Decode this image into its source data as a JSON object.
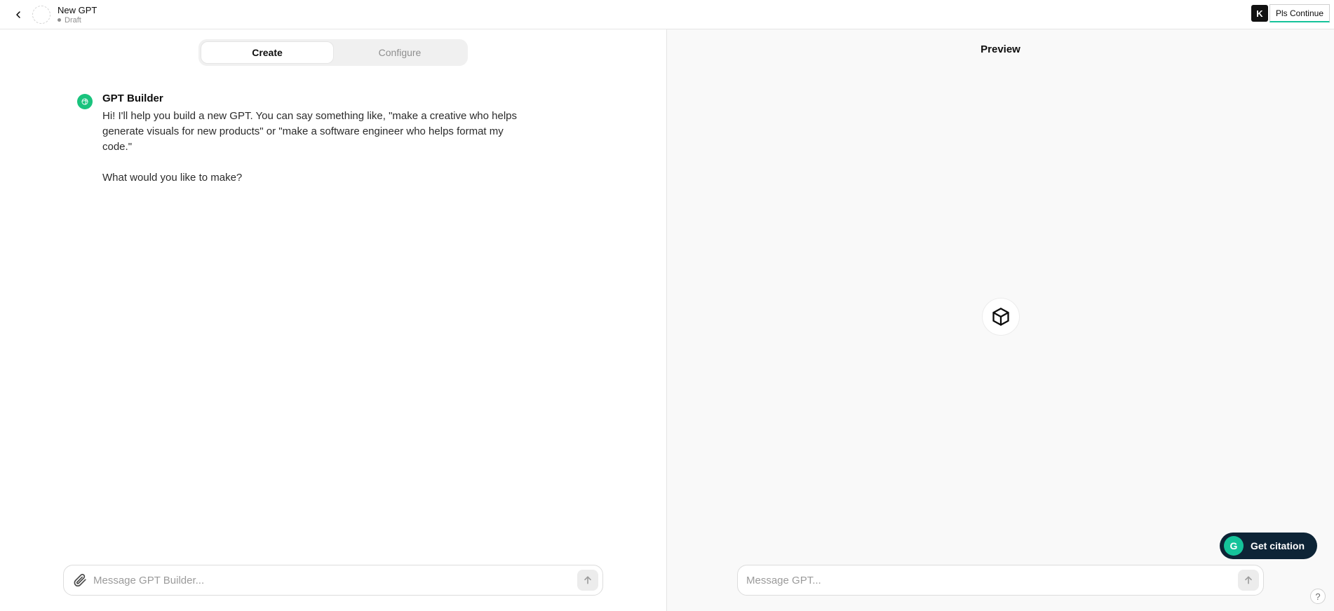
{
  "header": {
    "title": "New GPT",
    "status": "Draft",
    "ext_badge": "K",
    "ext_button_label": "Pls Continue"
  },
  "tabs": {
    "create": "Create",
    "configure": "Configure"
  },
  "builder": {
    "name": "GPT Builder",
    "message": "Hi! I'll help you build a new GPT. You can say something like, \"make a creative who helps generate visuals for new products\" or \"make a software engineer who helps format my code.\"\n\nWhat would you like to make?"
  },
  "inputs": {
    "builder_placeholder": "Message GPT Builder...",
    "preview_placeholder": "Message GPT..."
  },
  "preview": {
    "title": "Preview"
  },
  "citation": {
    "label": "Get citation",
    "icon_letter": "G"
  },
  "help": {
    "label": "?"
  }
}
